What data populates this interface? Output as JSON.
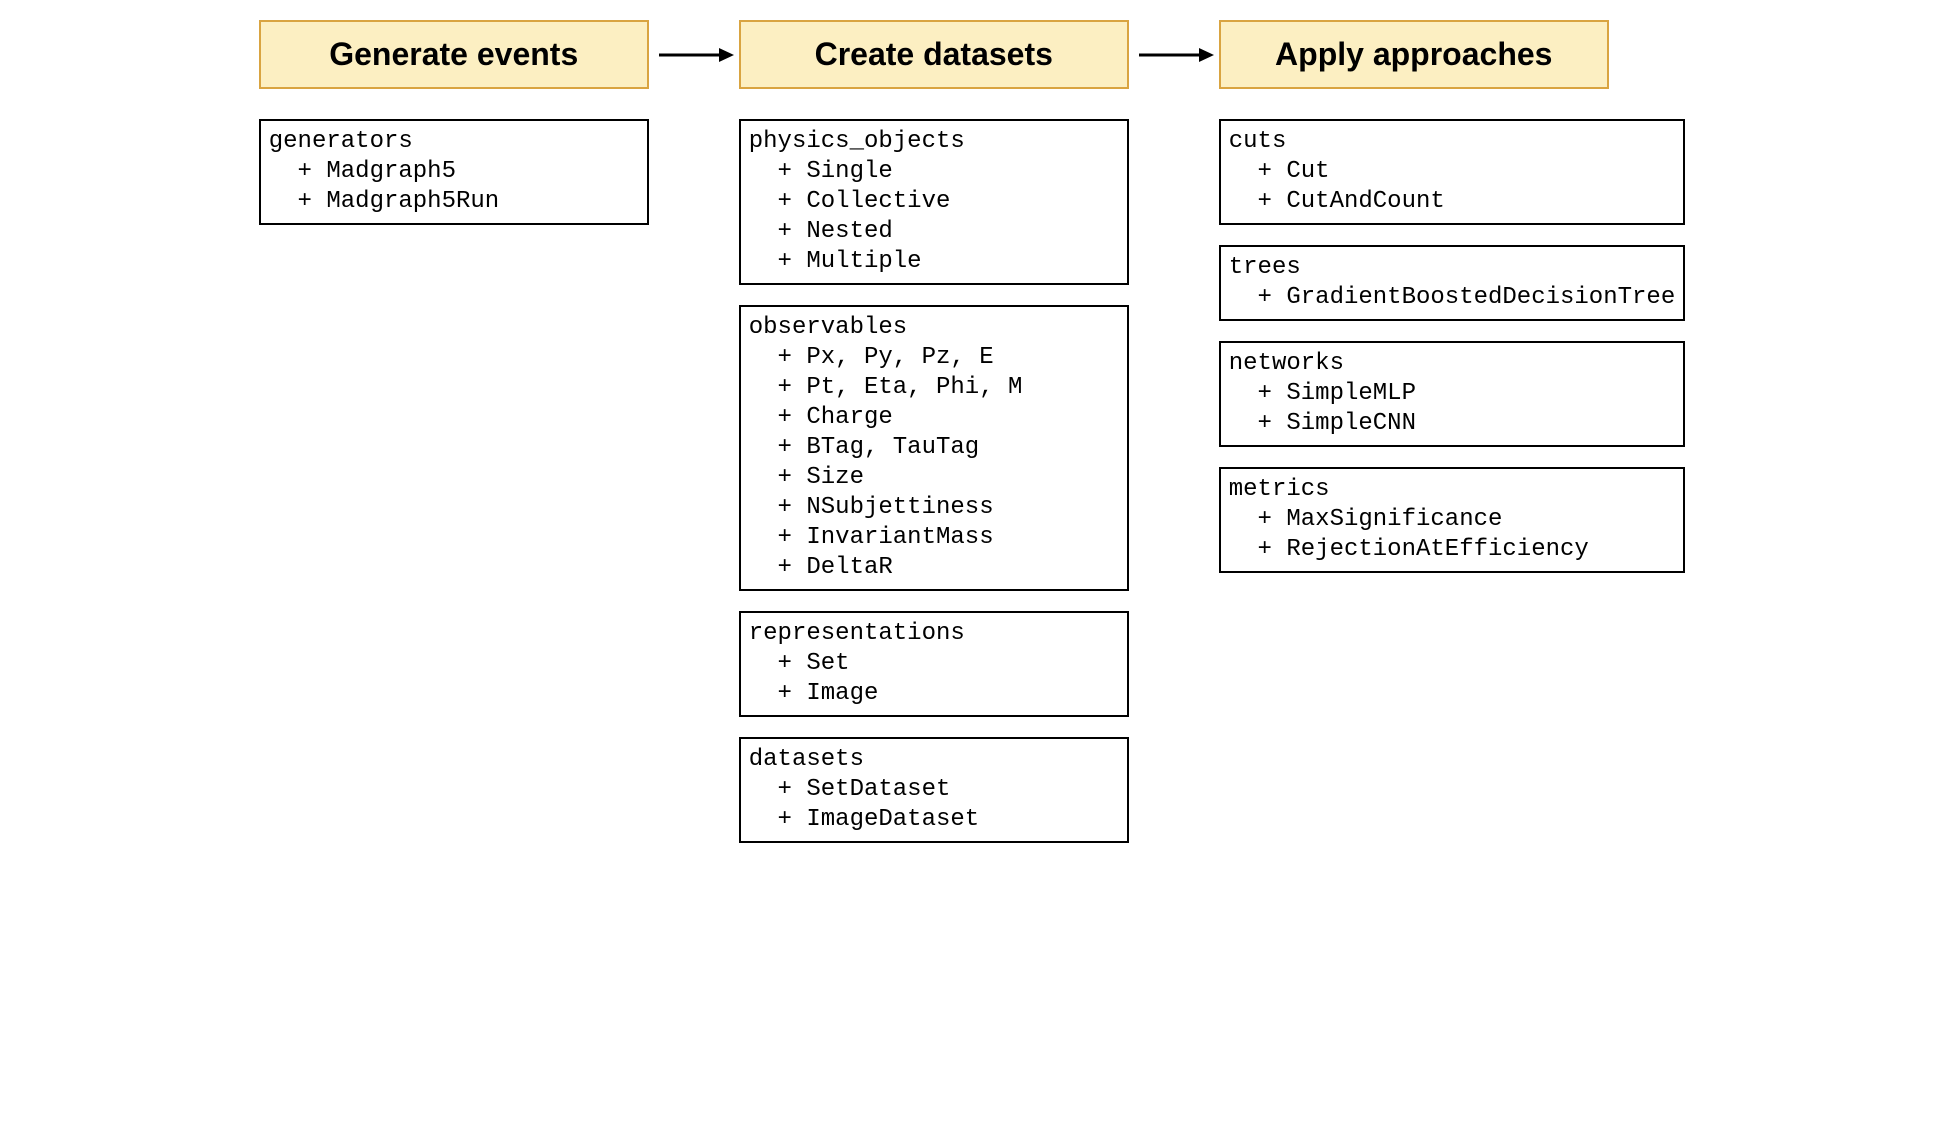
{
  "headers": {
    "col1": "Generate events",
    "col2": "Create datasets",
    "col3": "Apply approaches"
  },
  "col1": {
    "generators": {
      "title": "generators",
      "items": [
        "Madgraph5",
        "Madgraph5Run"
      ]
    }
  },
  "col2": {
    "physics_objects": {
      "title": "physics_objects",
      "items": [
        "Single",
        "Collective",
        "Nested",
        "Multiple"
      ]
    },
    "observables": {
      "title": "observables",
      "items": [
        "Px, Py, Pz, E",
        "Pt, Eta, Phi, M",
        "Charge",
        "BTag, TauTag",
        "Size",
        "NSubjettiness",
        "InvariantMass",
        "DeltaR"
      ]
    },
    "representations": {
      "title": "representations",
      "items": [
        "Set",
        "Image"
      ]
    },
    "datasets": {
      "title": "datasets",
      "items": [
        "SetDataset",
        "ImageDataset"
      ]
    }
  },
  "col3": {
    "cuts": {
      "title": "cuts",
      "items": [
        "Cut",
        "CutAndCount"
      ]
    },
    "trees": {
      "title": "trees",
      "items": [
        "GradientBoostedDecisionTree"
      ]
    },
    "networks": {
      "title": "networks",
      "items": [
        "SimpleMLP",
        "SimpleCNN"
      ]
    },
    "metrics": {
      "title": "metrics",
      "items": [
        "MaxSignificance",
        "RejectionAtEfficiency"
      ]
    }
  },
  "colors": {
    "header_bg": "#fcefc2",
    "header_border": "#d9a441",
    "box_border": "#000000"
  }
}
